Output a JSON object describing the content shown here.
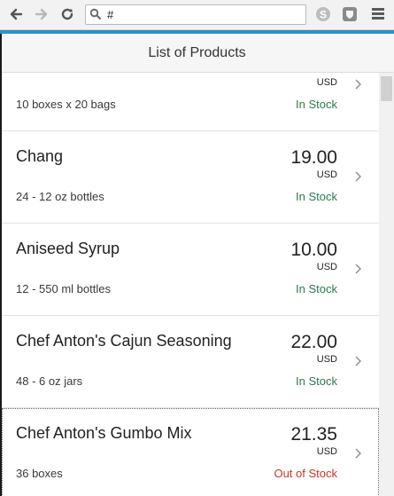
{
  "browser": {
    "address_text": "#",
    "icons": {
      "back": "back-arrow-icon",
      "forward": "forward-arrow-icon",
      "reload": "reload-icon",
      "search": "search-icon",
      "extension_1": "skype-icon",
      "extension_2": "shield-extension-icon",
      "menu": "hamburger-menu-icon"
    },
    "accent_color": "#2f8fc9"
  },
  "header": {
    "title": "List of Products"
  },
  "products": [
    {
      "name": "",
      "price": "",
      "currency": "USD",
      "unit": "10 boxes x 20 bags",
      "status": "In Stock",
      "status_color": "#2b7a4b"
    },
    {
      "name": "Chang",
      "price": "19.00",
      "currency": "USD",
      "unit": "24 - 12 oz bottles",
      "status": "In Stock",
      "status_color": "#2b7a4b"
    },
    {
      "name": "Aniseed Syrup",
      "price": "10.00",
      "currency": "USD",
      "unit": "12 - 550 ml bottles",
      "status": "In Stock",
      "status_color": "#2b7a4b"
    },
    {
      "name": "Chef Anton's Cajun Seasoning",
      "price": "22.00",
      "currency": "USD",
      "unit": "48 - 6 oz jars",
      "status": "In Stock",
      "status_color": "#2b7a4b"
    },
    {
      "name": "Chef Anton's Gumbo Mix",
      "price": "21.35",
      "currency": "USD",
      "unit": "36 boxes",
      "status": "Out of Stock",
      "status_color": "#c0392b"
    }
  ]
}
